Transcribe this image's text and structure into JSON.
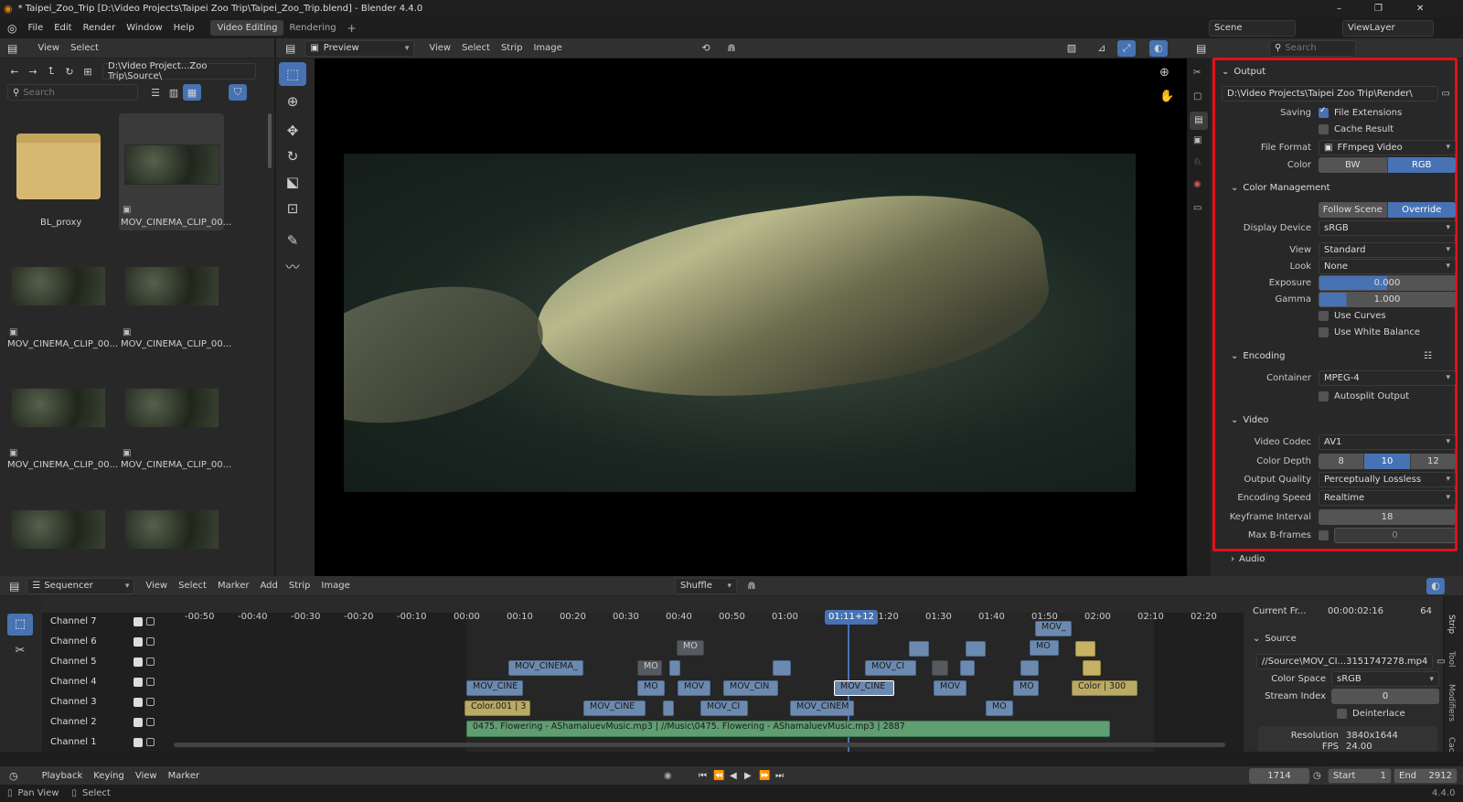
{
  "window": {
    "title": "* Taipei_Zoo_Trip [D:\\Video Projects\\Taipei Zoo Trip\\Taipei_Zoo_Trip.blend] - Blender 4.4.0",
    "min": "–",
    "max": "❐",
    "close": "✕"
  },
  "topbar": {
    "menus": [
      "File",
      "Edit",
      "Render",
      "Window",
      "Help"
    ],
    "tabs": [
      "Video Editing",
      "Rendering"
    ],
    "add": "+",
    "scene": "Scene",
    "viewlayer": "ViewLayer"
  },
  "filebrowser": {
    "menus": [
      "View",
      "Select"
    ],
    "path": "D:\\Video Project...Zoo Trip\\Source\\",
    "search_placeholder": "Search",
    "items": [
      "BL_proxy",
      "MOV_CINEMA_CLIP_00...",
      "MOV_CINEMA_CLIP_00...",
      "MOV_CINEMA_CLIP_00...",
      "MOV_CINEMA_CLIP_00...",
      "MOV_CINEMA_CLIP_00..."
    ]
  },
  "preview": {
    "mode": "Preview",
    "menus": [
      "View",
      "Select",
      "Strip",
      "Image"
    ]
  },
  "properties": {
    "search_placeholder": "Search",
    "output_title": "Output",
    "output_path": "D:\\Video Projects\\Taipei Zoo Trip\\Render\\",
    "saving_label": "Saving",
    "file_extensions": "File Extensions",
    "cache_result": "Cache Result",
    "file_format_label": "File Format",
    "file_format": "FFmpeg Video",
    "color_label": "Color",
    "color_bw": "BW",
    "color_rgb": "RGB",
    "cm_title": "Color Management",
    "follow_scene": "Follow Scene",
    "override": "Override",
    "display_device_label": "Display Device",
    "display_device": "sRGB",
    "view_label": "View",
    "view": "Standard",
    "look_label": "Look",
    "look": "None",
    "exposure_label": "Exposure",
    "exposure": "0.000",
    "gamma_label": "Gamma",
    "gamma": "1.000",
    "use_curves": "Use Curves",
    "use_white_balance": "Use White Balance",
    "encoding_title": "Encoding",
    "container_label": "Container",
    "container": "MPEG-4",
    "autosplit": "Autosplit Output",
    "video_title": "Video",
    "codec_label": "Video Codec",
    "codec": "AV1",
    "depth_label": "Color Depth",
    "depth": [
      "8",
      "10",
      "12"
    ],
    "quality_label": "Output Quality",
    "quality": "Perceptually Lossless",
    "speed_label": "Encoding Speed",
    "speed": "Realtime",
    "keyframe_label": "Keyframe Interval",
    "keyframe": "18",
    "bframes_label": "Max B-frames",
    "bframes": "0",
    "audio_title": "Audio"
  },
  "sequencer": {
    "mode": "Sequencer",
    "menus": [
      "View",
      "Select",
      "Marker",
      "Add",
      "Strip",
      "Image"
    ],
    "shuffle": "Shuffle",
    "channels": [
      "Channel 7",
      "Channel 6",
      "Channel 5",
      "Channel 4",
      "Channel 3",
      "Channel 2",
      "Channel 1"
    ],
    "ticks": [
      "-00:50",
      "-00:40",
      "-00:30",
      "-00:20",
      "-00:10",
      "00:00",
      "00:10",
      "00:20",
      "00:30",
      "00:40",
      "00:50",
      "01:00",
      "01:11+12",
      "01:20",
      "01:30",
      "01:40",
      "01:50",
      "02:00",
      "02:10",
      "02:20"
    ],
    "strips": {
      "a1": "MOV_",
      "a2": "MO",
      "a3": "MO",
      "a4": "MOV_CINEMA_",
      "a5": "MO",
      "a6": "MOV_CI",
      "a7": "MOV_CINE",
      "a8": "MO",
      "a9": "MOV",
      "a10": "MOV_CIN",
      "a11": "MOV_CINE",
      "a12": "MOV",
      "a13": "MO",
      "a14": "Color | 300",
      "a15": "Color.001 | 3",
      "a16": "MOV_CINE",
      "a17": "MOV_CI",
      "a18": "MOV_CINEM",
      "a19": "MO",
      "audio": "0475. Flowering - AShamaluevMusic.mp3 | //Music\\0475. Flowering - AShamaluevMusic.mp3 | 2887"
    }
  },
  "strip_panel": {
    "current_frame_label": "Current Fr...",
    "current_frame": "00:00:02:16",
    "current_frame_num": "64",
    "source_title": "Source",
    "source_path": "//Source\\MOV_CI...3151747278.mp4",
    "color_space_label": "Color Space",
    "color_space": "sRGB",
    "stream_label": "Stream Index",
    "stream": "0",
    "deinterlace": "Deinterlace",
    "resolution_label": "Resolution",
    "resolution": "3840x1644",
    "fps_label": "FPS",
    "fps": "24.00",
    "tabs": [
      "Strip",
      "Tool",
      "Modifiers",
      "Cache"
    ]
  },
  "playback": {
    "menus": [
      "Playback",
      "Keying",
      "View",
      "Marker"
    ],
    "frame": "1714",
    "start_label": "Start",
    "start": "1",
    "end_label": "End",
    "end": "2912"
  },
  "status": {
    "pan": "Pan View",
    "select": "Select",
    "version": "4.4.0"
  }
}
